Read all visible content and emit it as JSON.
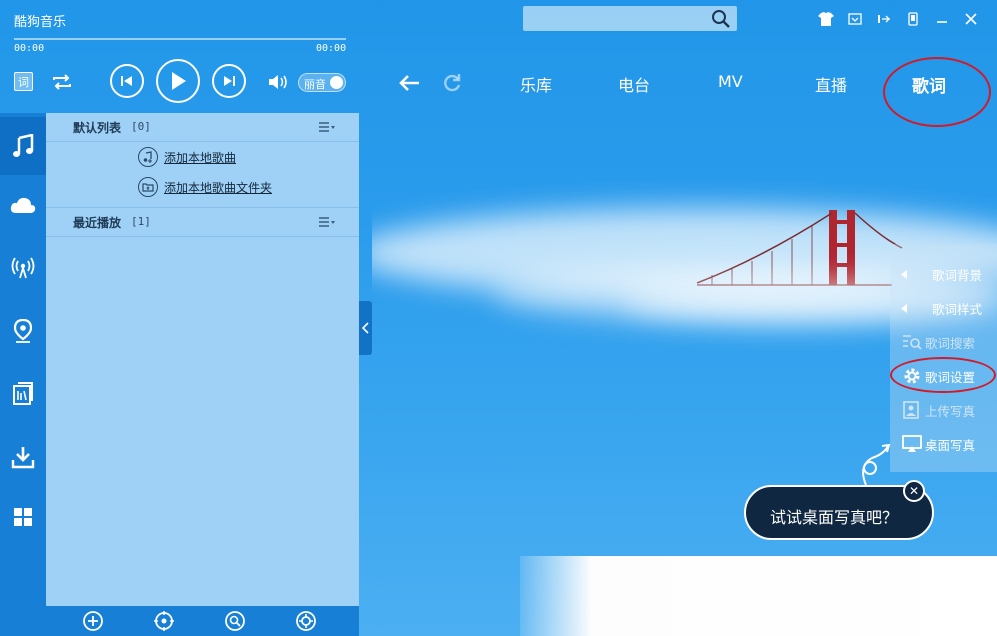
{
  "app": {
    "title": "酷狗音乐"
  },
  "search": {
    "placeholder": ""
  },
  "player": {
    "current_time": "00:00",
    "total_time": "00:00",
    "quality_label": "丽音",
    "lyric_button": "词"
  },
  "nav": {
    "tabs": [
      {
        "label": "乐库"
      },
      {
        "label": "电台"
      },
      {
        "label": "MV"
      },
      {
        "label": "直播"
      },
      {
        "label": "歌词"
      }
    ],
    "active": "歌词"
  },
  "playlists": [
    {
      "name": "默认列表",
      "count": "[0]",
      "expanded": true
    },
    {
      "name": "最近播放",
      "count": "[1]",
      "expanded": false
    }
  ],
  "add_actions": {
    "add_song": "添加本地歌曲",
    "add_folder": "添加本地歌曲文件夹"
  },
  "lyric_menu": {
    "items": [
      {
        "label": "歌词背景",
        "icon": "triangle-left-icon",
        "enabled": true
      },
      {
        "label": "歌词样式",
        "icon": "triangle-left-icon",
        "enabled": true
      },
      {
        "label": "歌词搜索",
        "icon": "lyric-search-icon",
        "enabled": false
      },
      {
        "label": "歌词设置",
        "icon": "gear-icon",
        "enabled": true
      },
      {
        "label": "上传写真",
        "icon": "upload-photo-icon",
        "enabled": false
      },
      {
        "label": "桌面写真",
        "icon": "desktop-photo-icon",
        "enabled": true
      }
    ]
  },
  "tooltip": {
    "text": "试试桌面写真吧？",
    "close": "✕"
  },
  "colors": {
    "accent": "#2196e8",
    "sidebar": "#1780d6",
    "playlist_bg": "#9fd0f6",
    "highlight": "#d11b2b",
    "tooltip_bg": "#0f2740"
  }
}
